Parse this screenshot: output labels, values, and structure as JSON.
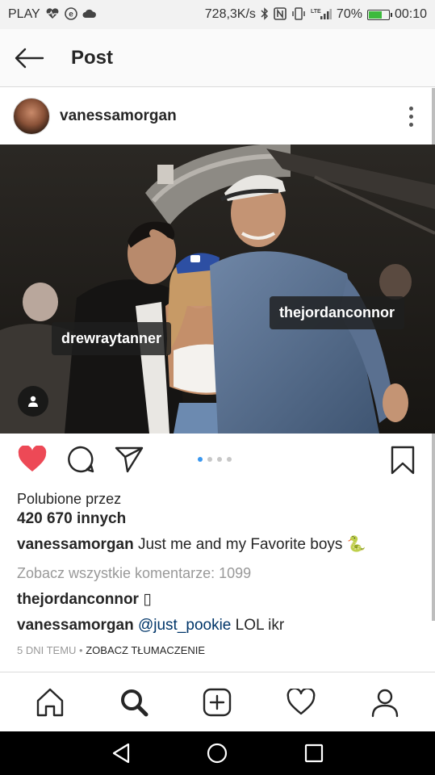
{
  "status_bar": {
    "carrier": "PLAY",
    "speed": "728,3K/s",
    "battery_percent": "70%",
    "battery_level": 0.7,
    "time": "00:10",
    "icons": [
      "heart-monitor-icon",
      "e-icon",
      "cloud-icon",
      "bluetooth-icon",
      "nfc-icon",
      "vibrate-icon",
      "lte-signal-icon",
      "battery-icon"
    ]
  },
  "header": {
    "title": "Post",
    "back_icon": "arrow-left-icon"
  },
  "post": {
    "username": "vanessamorgan",
    "tags": {
      "left": "drewraytanner",
      "right": "thejordanconnor"
    },
    "carousel": {
      "count": 4,
      "active": 1
    },
    "likes_label": "Polubione przez",
    "likes_count": "420 670 innych",
    "caption_user": "vanessamorgan",
    "caption_text": " Just me and my Favorite boys 🐍",
    "view_all": "Zobacz wszystkie komentarze: 1099",
    "comments": [
      {
        "user": "thejordanconnor",
        "text": " ▯"
      },
      {
        "user": "vanessamorgan",
        "mention": "@just_pookie",
        "text": " LOL ikr"
      }
    ],
    "meta_time": "5 DNI TEMU",
    "meta_separator": " • ",
    "meta_translate": "ZOBACZ TŁUMACZENIE"
  },
  "colors": {
    "like_red": "#ed4956",
    "carousel_active": "#3897f0",
    "mention_blue": "#003569",
    "muted_gray": "#999999"
  },
  "bottom_nav": [
    "home-icon",
    "search-icon",
    "add-post-icon",
    "activity-heart-icon",
    "profile-icon"
  ],
  "android_nav": [
    "back-triangle-icon",
    "home-circle-icon",
    "recents-square-icon"
  ]
}
